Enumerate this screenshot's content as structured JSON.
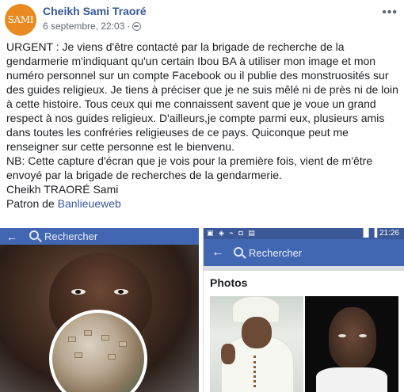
{
  "post": {
    "avatar_text": "SAMI",
    "author": "Cheikh Sami Traoré",
    "timestamp": "6 septembre, 22:03",
    "separator": "·",
    "more_icon": "ellipsis-icon",
    "privacy_icon": "globe-icon",
    "paragraphs": [
      "URGENT : Je viens d'être contacté par la brigade de recherche de la gendarmerie m'indiquant qu'un certain Ibou BA à utiliser mon image et mon numéro personnel sur un compte Facebook ou il publie des monstruosités sur des guides religieux. Je tiens à préciser que je ne suis mêlé ni de près ni de loin à cette histoire. Tous ceux qui me connaissent savent que je voue un grand respect à nos guides religieux. D'ailleurs,je compte parmi eux, plusieurs amis dans toutes les confréries religieuses de ce pays. Quiconque peut me renseigner sur cette personne est le bienvenu.",
      "NB: Cette capture d'écran que je vois pour la première fois, vient de m'être envoyé par la brigade de recherches de la gendarmerie.",
      "Cheikh TRAORÉ Sami"
    ],
    "signature_prefix": "Patron de ",
    "signature_link": "Banlieueweb"
  },
  "screenshot_left": {
    "back_glyph": "←",
    "search_label": "Rechercher"
  },
  "screenshot_right": {
    "status_left": "▣ ◈ ⌁ ◘ ▤",
    "status_right": "▐▌▐ 21:26",
    "back_glyph": "←",
    "search_label": "Rechercher",
    "section_title": "Photos"
  },
  "colors": {
    "facebook_blue": "#4267b2",
    "link_blue": "#385898",
    "avatar_orange": "#e88a1f"
  }
}
